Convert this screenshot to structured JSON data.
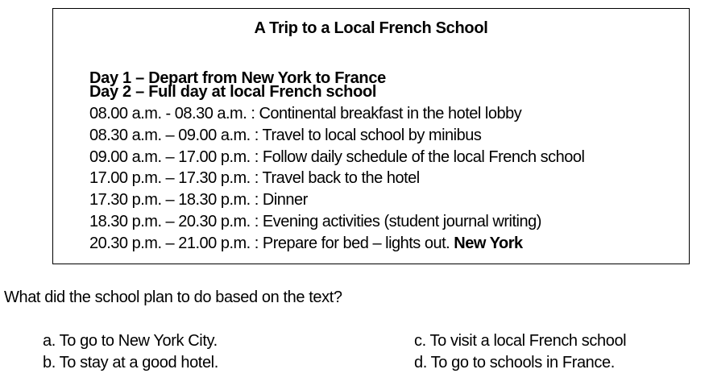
{
  "passage": {
    "title": "A Trip to a Local French School",
    "day1": "Day 1 – Depart from New York to France",
    "day2": "Day 2 – Full day at local French school",
    "schedule": [
      {
        "text": "08.00 a.m. - 08.30 a.m.  : Continental breakfast in the hotel lobby",
        "bold_tail": ""
      },
      {
        "text": "08.30 a.m. – 09.00 a.m.  : Travel to local school by minibus",
        "bold_tail": ""
      },
      {
        "text": "09.00 a.m. – 17.00 p.m.  : Follow daily schedule of the local French school",
        "bold_tail": ""
      },
      {
        "text": "17.00 p.m. – 17.30 p.m. : Travel back to the hotel",
        "bold_tail": ""
      },
      {
        "text": "17.30 p.m. – 18.30 p.m. : Dinner",
        "bold_tail": ""
      },
      {
        "text": "18.30 p.m. – 20.30 p.m. : Evening activities (student journal writing)",
        "bold_tail": ""
      },
      {
        "text": "20.30 p.m. – 21.00 p.m. : Prepare for bed – lights out. ",
        "bold_tail": "New York"
      }
    ]
  },
  "question": {
    "prompt": "What did the school plan to do based on the text?",
    "options": {
      "a": "a. To go to New York City.",
      "b": "b. To stay at a good hotel.",
      "c": "c. To visit a local French school",
      "d": "d. To go to schools in France."
    }
  }
}
